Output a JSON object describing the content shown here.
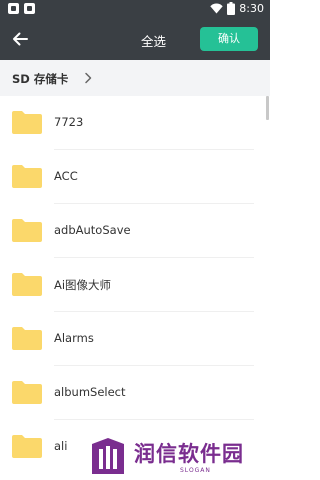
{
  "status_bar": {
    "time": "8:30"
  },
  "app_bar": {
    "select_all_label": "全选",
    "confirm_label": "确认"
  },
  "path": {
    "label": "SD 存储卡"
  },
  "folders": [
    {
      "name": "7723"
    },
    {
      "name": "ACC"
    },
    {
      "name": "adbAutoSave"
    },
    {
      "name": "Ai图像大师"
    },
    {
      "name": "Alarms"
    },
    {
      "name": "albumSelect"
    },
    {
      "name": "ali"
    }
  ],
  "watermark": {
    "name": "润信软件园",
    "slogan": "SLOGAN"
  },
  "colors": {
    "app_bar": "#3a3f44",
    "accent": "#25c196",
    "folder": "#fbd86b",
    "watermark": "#7a2d8f"
  },
  "icons": [
    "back-arrow-icon",
    "chevron-right-icon",
    "folder-icon",
    "wifi-icon",
    "battery-icon"
  ]
}
